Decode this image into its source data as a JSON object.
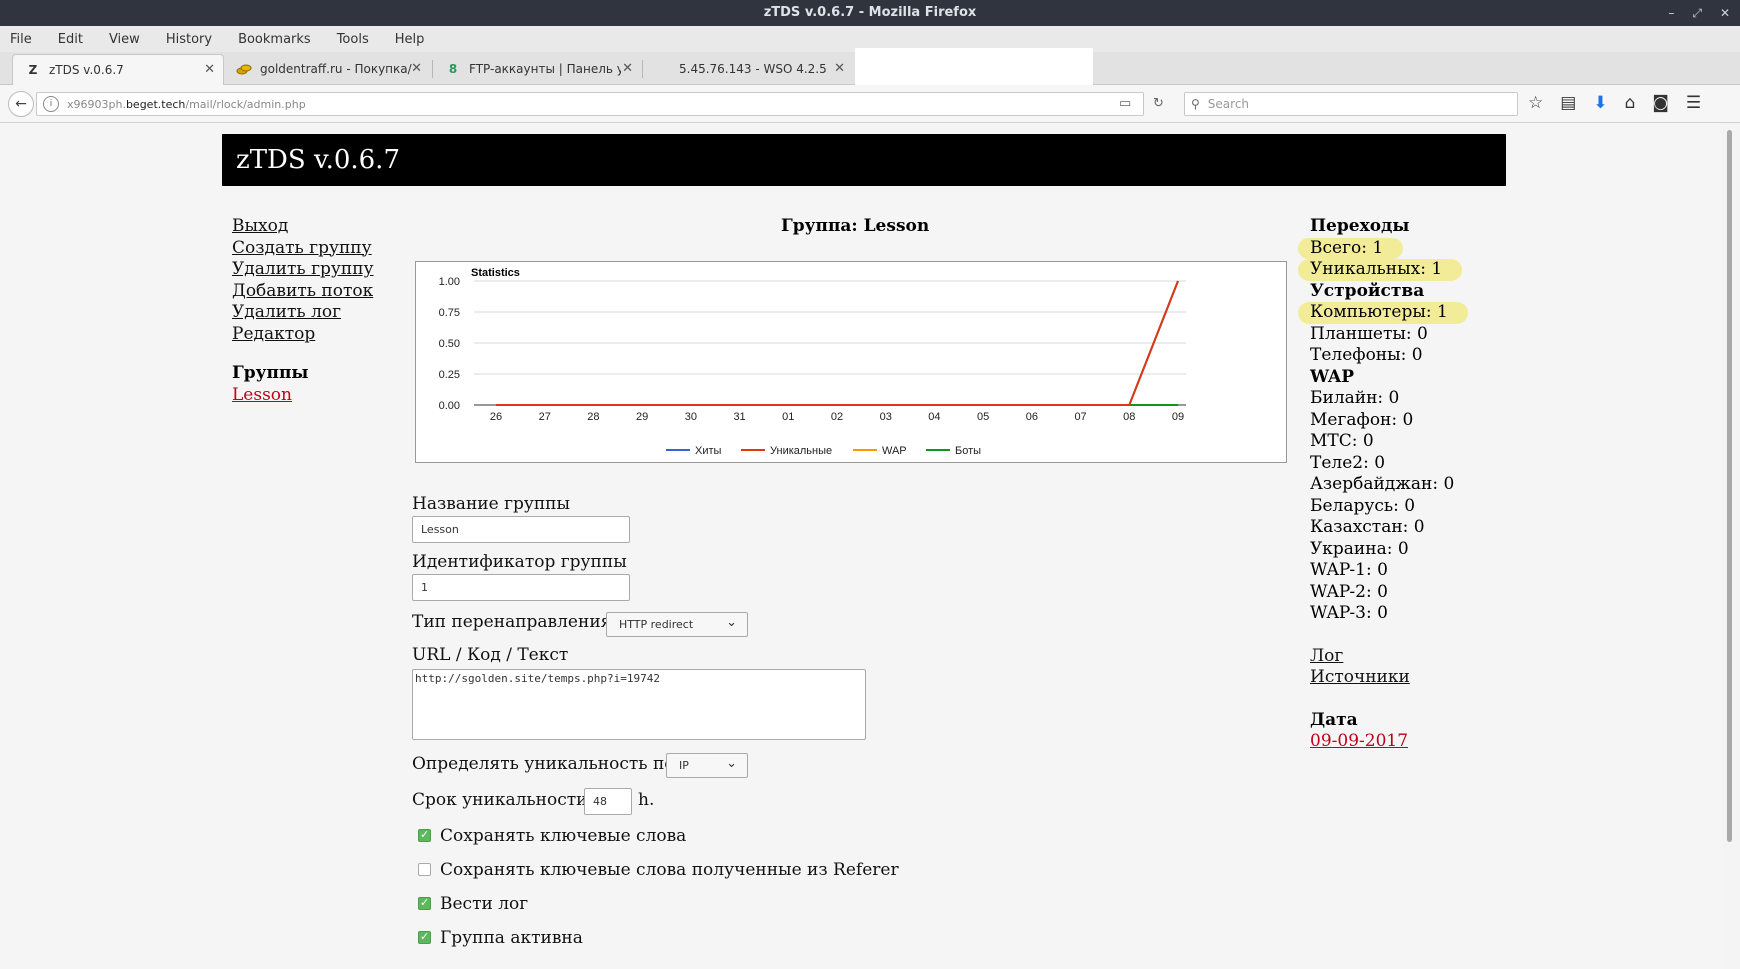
{
  "window": {
    "title": "zTDS v.0.6.7 - Mozilla Firefox"
  },
  "menu": [
    "File",
    "Edit",
    "View",
    "History",
    "Bookmarks",
    "Tools",
    "Help"
  ],
  "tabs": [
    {
      "label": "zTDS v.0.6.7",
      "icon": "Z"
    },
    {
      "label": "goldentraff.ru - Покупка/пр",
      "icon": "gold-coins-icon"
    },
    {
      "label": "FTP-аккаунты | Панель упр",
      "icon": "8"
    },
    {
      "label": "5.45.76.143 - WSO 4.2.5",
      "icon": ""
    }
  ],
  "urlbar": {
    "prefix": "x96903ph.",
    "domain": "beget.tech",
    "path": "/mail/rlock/admin.php"
  },
  "search": {
    "placeholder": "Search"
  },
  "app": {
    "title": "zTDS v.0.6.7"
  },
  "leftnav": {
    "links": [
      "Выход",
      "Создать группу",
      "Удалить группу",
      "Добавить поток",
      "Удалить лог",
      "Редактор"
    ],
    "groups_title": "Группы",
    "groups": [
      "Lesson"
    ]
  },
  "group_title": "Группа: Lesson",
  "chart_data": {
    "type": "line",
    "title": "Statistics",
    "categories": [
      "26",
      "27",
      "28",
      "29",
      "30",
      "31",
      "01",
      "02",
      "03",
      "04",
      "05",
      "06",
      "07",
      "08",
      "09"
    ],
    "ylim": [
      0,
      1
    ],
    "yticks": [
      "1.00",
      "0.75",
      "0.50",
      "0.25",
      "0.00"
    ],
    "grid": true,
    "legend_position": "bottom",
    "series": [
      {
        "name": "Хиты",
        "color": "#3366cc",
        "values": [
          0,
          0,
          0,
          0,
          0,
          0,
          0,
          0,
          0,
          0,
          0,
          0,
          0,
          0,
          1
        ]
      },
      {
        "name": "Уникальные",
        "color": "#dc3912",
        "values": [
          0,
          0,
          0,
          0,
          0,
          0,
          0,
          0,
          0,
          0,
          0,
          0,
          0,
          0,
          1
        ]
      },
      {
        "name": "WAP",
        "color": "#ff9900",
        "values": [
          0,
          0,
          0,
          0,
          0,
          0,
          0,
          0,
          0,
          0,
          0,
          0,
          0,
          0,
          0
        ]
      },
      {
        "name": "Боты",
        "color": "#109618",
        "values": [
          0,
          0,
          0,
          0,
          0,
          0,
          0,
          0,
          0,
          0,
          0,
          0,
          0,
          0,
          0
        ]
      }
    ]
  },
  "form": {
    "group_name_label": "Название группы",
    "group_name_value": "Lesson",
    "group_id_label": "Идентификатор группы",
    "group_id_value": "1",
    "redirect_label": "Тип перенаправления",
    "redirect_value": "HTTP redirect",
    "url_label": "URL / Код / Текст",
    "url_value": "http://sgolden.site/temps.php?i=19742",
    "unique_by_label": "Определять уникальность по",
    "unique_by_value": "IP",
    "unique_term_label": "Срок уникальности",
    "unique_term_value": "48",
    "unique_term_unit": "h.",
    "checkboxes": [
      {
        "label": "Сохранять ключевые слова",
        "checked": true
      },
      {
        "label": "Сохранять ключевые слова полученные из Referer",
        "checked": false
      },
      {
        "label": "Вести лог",
        "checked": true
      },
      {
        "label": "Группа активна",
        "checked": true
      }
    ]
  },
  "stats": {
    "transitions_title": "Переходы",
    "total": "Всего: 1",
    "unique": "Уникальных: 1",
    "devices_title": "Устройства",
    "computers": "Компьютеры: 1",
    "tablets": "Планшеты: 0",
    "phones": "Телефоны: 0",
    "wap_title": "WAP",
    "wap_items": [
      "Билайн: 0",
      "Мегафон: 0",
      "МТС: 0",
      "Теле2: 0",
      "Азербайджан: 0",
      "Беларусь: 0",
      "Казахстан: 0",
      "Украина: 0",
      "WAP-1: 0",
      "WAP-2: 0",
      "WAP-3: 0"
    ],
    "log_link": "Лог",
    "sources_link": "Источники",
    "date_title": "Дата",
    "date_value": "09-09-2017"
  }
}
